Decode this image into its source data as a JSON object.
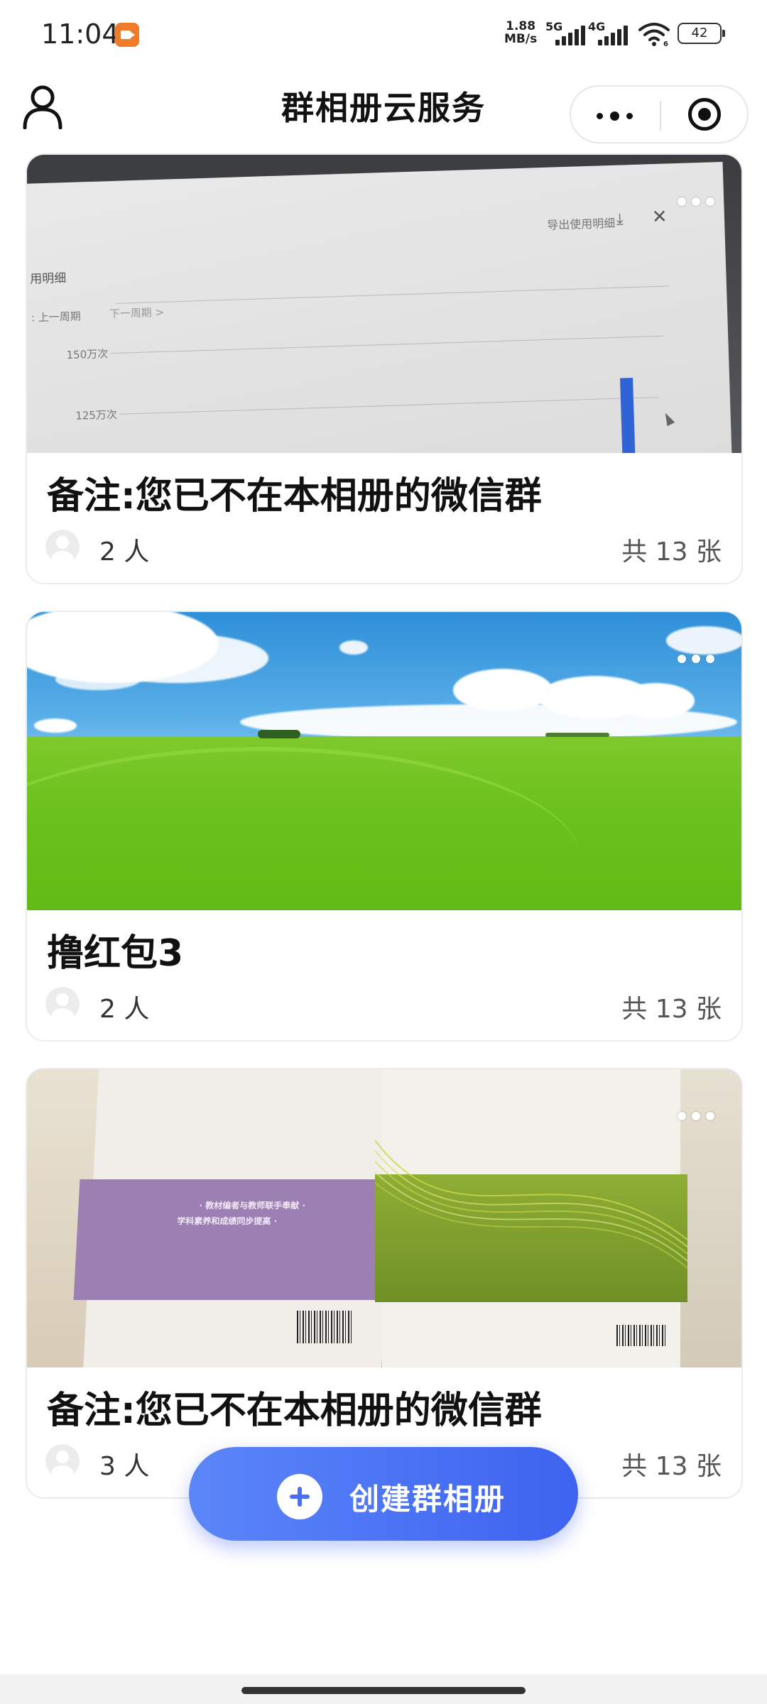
{
  "status_bar": {
    "time": "11:04",
    "net_speed_value": "1.88",
    "net_speed_unit": "MB/s",
    "net1": "5G",
    "net2": "4G",
    "wifi_sub": "6",
    "battery": "42",
    "colors": {
      "recorder_icon": "#f07c2a"
    }
  },
  "nav": {
    "title": "群相册云服务",
    "icons": {
      "profile": "user-icon",
      "more": "more-dots-icon",
      "mini_program": "target-icon"
    }
  },
  "albums": [
    {
      "title": "备注:您已不在本相册的微信群",
      "members": "2 人",
      "photos": "共 13 张",
      "cover": {
        "kind": "monitor-screenshot",
        "export_text": "导出使用明细",
        "panel_title": "用明细",
        "prev_period": ": 上一周期",
        "next_period": "下一周期 >",
        "tick_150": "150万次",
        "tick_125": "125万次"
      }
    },
    {
      "title": "撸红包3",
      "members": "2 人",
      "photos": "共 13 张",
      "cover": {
        "kind": "green-meadow-blue-sky"
      }
    },
    {
      "title": "备注:您已不在本相册的微信群",
      "members": "3 人",
      "photos": "共 13 张",
      "cover": {
        "kind": "textbook-covers",
        "purple_line1": "· 教材编者与教师联手奉献 ·",
        "purple_line2": "学科素养和成绩同步提高 ·"
      }
    }
  ],
  "create_button": {
    "label": "创建群相册",
    "accent": "#4a6ef4"
  }
}
